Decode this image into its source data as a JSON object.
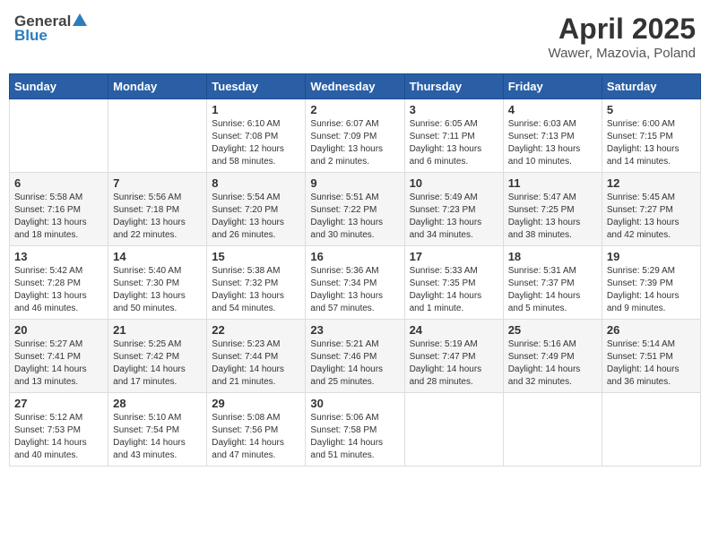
{
  "header": {
    "logo_general": "General",
    "logo_blue": "Blue",
    "month_title": "April 2025",
    "location": "Wawer, Mazovia, Poland"
  },
  "days_of_week": [
    "Sunday",
    "Monday",
    "Tuesday",
    "Wednesday",
    "Thursday",
    "Friday",
    "Saturday"
  ],
  "weeks": [
    [
      {
        "day": "",
        "info": ""
      },
      {
        "day": "",
        "info": ""
      },
      {
        "day": "1",
        "info": "Sunrise: 6:10 AM\nSunset: 7:08 PM\nDaylight: 12 hours\nand 58 minutes."
      },
      {
        "day": "2",
        "info": "Sunrise: 6:07 AM\nSunset: 7:09 PM\nDaylight: 13 hours\nand 2 minutes."
      },
      {
        "day": "3",
        "info": "Sunrise: 6:05 AM\nSunset: 7:11 PM\nDaylight: 13 hours\nand 6 minutes."
      },
      {
        "day": "4",
        "info": "Sunrise: 6:03 AM\nSunset: 7:13 PM\nDaylight: 13 hours\nand 10 minutes."
      },
      {
        "day": "5",
        "info": "Sunrise: 6:00 AM\nSunset: 7:15 PM\nDaylight: 13 hours\nand 14 minutes."
      }
    ],
    [
      {
        "day": "6",
        "info": "Sunrise: 5:58 AM\nSunset: 7:16 PM\nDaylight: 13 hours\nand 18 minutes."
      },
      {
        "day": "7",
        "info": "Sunrise: 5:56 AM\nSunset: 7:18 PM\nDaylight: 13 hours\nand 22 minutes."
      },
      {
        "day": "8",
        "info": "Sunrise: 5:54 AM\nSunset: 7:20 PM\nDaylight: 13 hours\nand 26 minutes."
      },
      {
        "day": "9",
        "info": "Sunrise: 5:51 AM\nSunset: 7:22 PM\nDaylight: 13 hours\nand 30 minutes."
      },
      {
        "day": "10",
        "info": "Sunrise: 5:49 AM\nSunset: 7:23 PM\nDaylight: 13 hours\nand 34 minutes."
      },
      {
        "day": "11",
        "info": "Sunrise: 5:47 AM\nSunset: 7:25 PM\nDaylight: 13 hours\nand 38 minutes."
      },
      {
        "day": "12",
        "info": "Sunrise: 5:45 AM\nSunset: 7:27 PM\nDaylight: 13 hours\nand 42 minutes."
      }
    ],
    [
      {
        "day": "13",
        "info": "Sunrise: 5:42 AM\nSunset: 7:28 PM\nDaylight: 13 hours\nand 46 minutes."
      },
      {
        "day": "14",
        "info": "Sunrise: 5:40 AM\nSunset: 7:30 PM\nDaylight: 13 hours\nand 50 minutes."
      },
      {
        "day": "15",
        "info": "Sunrise: 5:38 AM\nSunset: 7:32 PM\nDaylight: 13 hours\nand 54 minutes."
      },
      {
        "day": "16",
        "info": "Sunrise: 5:36 AM\nSunset: 7:34 PM\nDaylight: 13 hours\nand 57 minutes."
      },
      {
        "day": "17",
        "info": "Sunrise: 5:33 AM\nSunset: 7:35 PM\nDaylight: 14 hours\nand 1 minute."
      },
      {
        "day": "18",
        "info": "Sunrise: 5:31 AM\nSunset: 7:37 PM\nDaylight: 14 hours\nand 5 minutes."
      },
      {
        "day": "19",
        "info": "Sunrise: 5:29 AM\nSunset: 7:39 PM\nDaylight: 14 hours\nand 9 minutes."
      }
    ],
    [
      {
        "day": "20",
        "info": "Sunrise: 5:27 AM\nSunset: 7:41 PM\nDaylight: 14 hours\nand 13 minutes."
      },
      {
        "day": "21",
        "info": "Sunrise: 5:25 AM\nSunset: 7:42 PM\nDaylight: 14 hours\nand 17 minutes."
      },
      {
        "day": "22",
        "info": "Sunrise: 5:23 AM\nSunset: 7:44 PM\nDaylight: 14 hours\nand 21 minutes."
      },
      {
        "day": "23",
        "info": "Sunrise: 5:21 AM\nSunset: 7:46 PM\nDaylight: 14 hours\nand 25 minutes."
      },
      {
        "day": "24",
        "info": "Sunrise: 5:19 AM\nSunset: 7:47 PM\nDaylight: 14 hours\nand 28 minutes."
      },
      {
        "day": "25",
        "info": "Sunrise: 5:16 AM\nSunset: 7:49 PM\nDaylight: 14 hours\nand 32 minutes."
      },
      {
        "day": "26",
        "info": "Sunrise: 5:14 AM\nSunset: 7:51 PM\nDaylight: 14 hours\nand 36 minutes."
      }
    ],
    [
      {
        "day": "27",
        "info": "Sunrise: 5:12 AM\nSunset: 7:53 PM\nDaylight: 14 hours\nand 40 minutes."
      },
      {
        "day": "28",
        "info": "Sunrise: 5:10 AM\nSunset: 7:54 PM\nDaylight: 14 hours\nand 43 minutes."
      },
      {
        "day": "29",
        "info": "Sunrise: 5:08 AM\nSunset: 7:56 PM\nDaylight: 14 hours\nand 47 minutes."
      },
      {
        "day": "30",
        "info": "Sunrise: 5:06 AM\nSunset: 7:58 PM\nDaylight: 14 hours\nand 51 minutes."
      },
      {
        "day": "",
        "info": ""
      },
      {
        "day": "",
        "info": ""
      },
      {
        "day": "",
        "info": ""
      }
    ]
  ]
}
